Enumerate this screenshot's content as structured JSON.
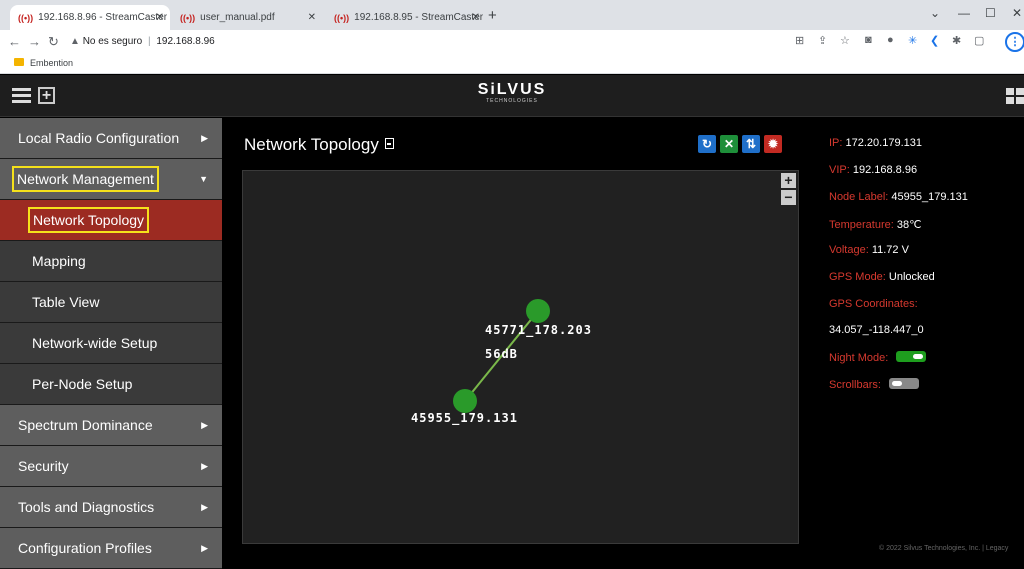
{
  "browser": {
    "tabs": [
      {
        "favicon": "((•))",
        "title": "192.168.8.96 - StreamCaster MIM",
        "active": true
      },
      {
        "favicon": "((•))",
        "title": "user_manual.pdf",
        "active": false
      },
      {
        "favicon": "((•))",
        "title": "192.168.8.95 - StreamCaster MIM",
        "active": false
      }
    ],
    "address": {
      "security": "No es seguro",
      "url": "192.168.8.96"
    },
    "bookmarks": [
      {
        "label": "Embention"
      }
    ]
  },
  "header": {
    "logo_word": "SiLVUS",
    "logo_sub": "TECHNOLOGIES"
  },
  "sidebar": {
    "items": [
      {
        "label": "Local Radio Configuration",
        "arrow": "▶"
      },
      {
        "label": "Network Management",
        "arrow": "▼"
      },
      {
        "label": "Network Topology"
      },
      {
        "label": "Mapping"
      },
      {
        "label": "Table View"
      },
      {
        "label": "Network-wide Setup"
      },
      {
        "label": "Per-Node Setup"
      },
      {
        "label": "Spectrum Dominance",
        "arrow": "▶"
      },
      {
        "label": "Security",
        "arrow": "▶"
      },
      {
        "label": "Tools and Diagnostics",
        "arrow": "▶"
      },
      {
        "label": "Configuration Profiles",
        "arrow": "▶"
      }
    ]
  },
  "main": {
    "title": "Network Topology",
    "toolbar": {
      "refresh_color": "#1f6fc9",
      "layout_color": "#1e8f3a",
      "sort_color": "#1f6fc9",
      "settings_color": "#c22a22"
    },
    "topology": {
      "nodes": [
        {
          "label": "45771_178.203"
        },
        {
          "label": "45955_179.131"
        }
      ],
      "link_label": "56dB",
      "node_color": "#2a9a2a",
      "link_color": "#7ab84a"
    }
  },
  "info": {
    "ip_key": "IP:",
    "ip": "172.20.179.131",
    "vip_key": "VIP:",
    "vip": "192.168.8.96",
    "node_label_key": "Node Label:",
    "node_label": "45955_179.131",
    "temperature_key": "Temperature:",
    "temperature": "38℃",
    "voltage_key": "Voltage:",
    "voltage": "11.72 V",
    "gps_mode_key": "GPS Mode:",
    "gps_mode": "Unlocked",
    "gps_coords_key": "GPS Coordinates:",
    "gps_coords": "34.057_-118.447_0",
    "night_mode_key": "Night Mode:",
    "night_mode": true,
    "scrollbars_key": "Scrollbars:",
    "scrollbars": false
  },
  "footer": "© 2022 Silvus Technologies, Inc. | Legacy"
}
